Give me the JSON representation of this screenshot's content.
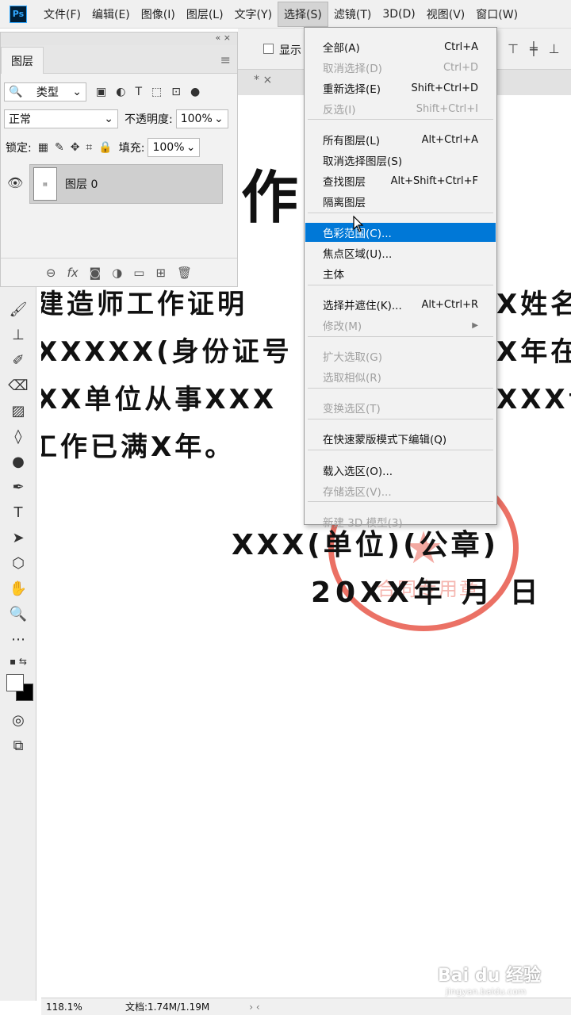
{
  "menubar": {
    "logo": "Ps",
    "items": [
      "文件(F)",
      "编辑(E)",
      "图像(I)",
      "图层(L)",
      "文字(Y)",
      "选择(S)",
      "滤镜(T)",
      "3D(D)",
      "视图(V)",
      "窗口(W)"
    ]
  },
  "options_bar": {
    "show_label": "显示"
  },
  "layers_panel": {
    "top_controls": "«  ×",
    "tab": "图层",
    "filter_kind": "类型",
    "blend_mode": "正常",
    "opacity_label": "不透明度:",
    "opacity_value": "100%",
    "lock_label": "锁定:",
    "fill_label": "填充:",
    "fill_value": "100%",
    "layer_name": "图层 0"
  },
  "document": {
    "title": "作 证",
    "lines": [
      "建造师工作证明",
      "XXXXX(身份证号",
      "XX单位从事XXX",
      "工作已满X年。"
    ],
    "right_fragments": [
      "X姓名",
      "X年在",
      "XXX专"
    ],
    "signature": "XXX(单位)(公章)",
    "date": "20XX年  月  日",
    "stamp_text": "合同专用章"
  },
  "select_menu": {
    "items": [
      {
        "label": "全部(A)",
        "shortcut": "Ctrl+A",
        "disabled": false
      },
      {
        "label": "取消选择(D)",
        "shortcut": "Ctrl+D",
        "disabled": true
      },
      {
        "label": "重新选择(E)",
        "shortcut": "Shift+Ctrl+D",
        "disabled": false
      },
      {
        "label": "反选(I)",
        "shortcut": "Shift+Ctrl+I",
        "disabled": true
      },
      {
        "label": "所有图层(L)",
        "shortcut": "Alt+Ctrl+A",
        "disabled": false
      },
      {
        "label": "取消选择图层(S)",
        "shortcut": "",
        "disabled": false
      },
      {
        "label": "查找图层",
        "shortcut": "Alt+Shift+Ctrl+F",
        "disabled": false
      },
      {
        "label": "隔离图层",
        "shortcut": "",
        "disabled": false
      },
      {
        "label": "色彩范围(C)...",
        "shortcut": "",
        "disabled": false,
        "highlighted": true
      },
      {
        "label": "焦点区域(U)...",
        "shortcut": "",
        "disabled": false
      },
      {
        "label": "主体",
        "shortcut": "",
        "disabled": false
      },
      {
        "label": "选择并遮住(K)...",
        "shortcut": "Alt+Ctrl+R",
        "disabled": false
      },
      {
        "label": "修改(M)",
        "shortcut": "",
        "disabled": true,
        "submenu": true
      },
      {
        "label": "扩大选取(G)",
        "shortcut": "",
        "disabled": true
      },
      {
        "label": "选取相似(R)",
        "shortcut": "",
        "disabled": true
      },
      {
        "label": "变换选区(T)",
        "shortcut": "",
        "disabled": true
      },
      {
        "label": "在快速蒙版模式下编辑(Q)",
        "shortcut": "",
        "disabled": false
      },
      {
        "label": "载入选区(O)...",
        "shortcut": "",
        "disabled": false
      },
      {
        "label": "存储选区(V)...",
        "shortcut": "",
        "disabled": true
      },
      {
        "label": "新建 3D 模型(3)",
        "shortcut": "",
        "disabled": true
      }
    ]
  },
  "status_bar": {
    "zoom": "118.1%",
    "doc_info": "文档:1.74M/1.19M"
  },
  "watermark": {
    "brand": "Bai du 经验",
    "url": "jingyan.baidu.com"
  },
  "colors": {
    "highlight": "#0078d7",
    "stamp": "#e8584a"
  }
}
